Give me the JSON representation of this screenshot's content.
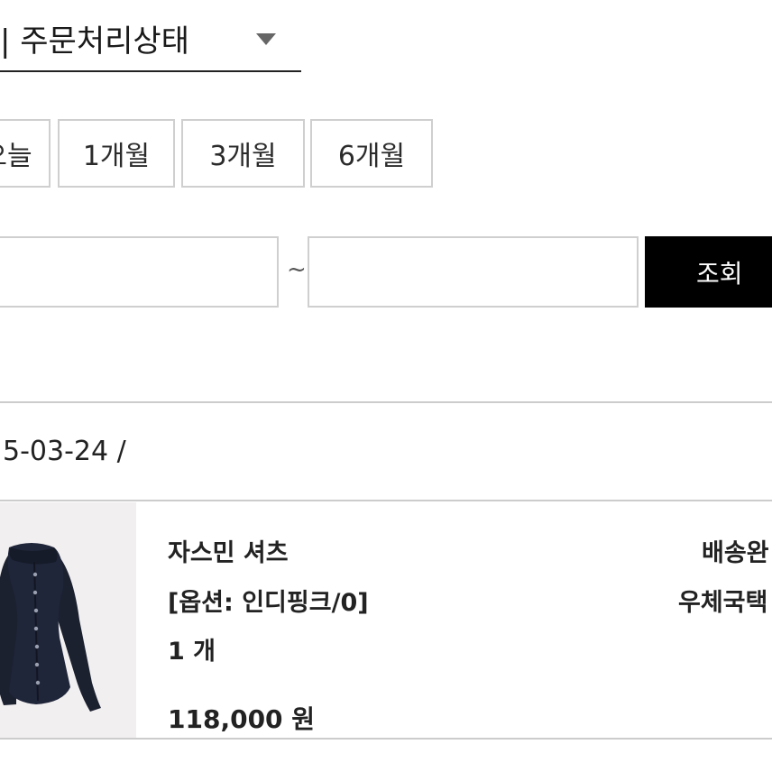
{
  "filter": {
    "status_select_label": "| 주문처리상태",
    "period_buttons": [
      "오늘",
      "1개월",
      "3개월",
      "6개월"
    ],
    "date_range_separator": "~",
    "search_button_label": "조회"
  },
  "order": {
    "date_label": "5-03-24 / ",
    "item": {
      "name": "자스민 셔츠",
      "option": "[옵션: 인디핑크/0]",
      "quantity": "1 개",
      "price": "118,000 원",
      "delivery_status": "배송완",
      "carrier": "우체국택"
    }
  }
}
